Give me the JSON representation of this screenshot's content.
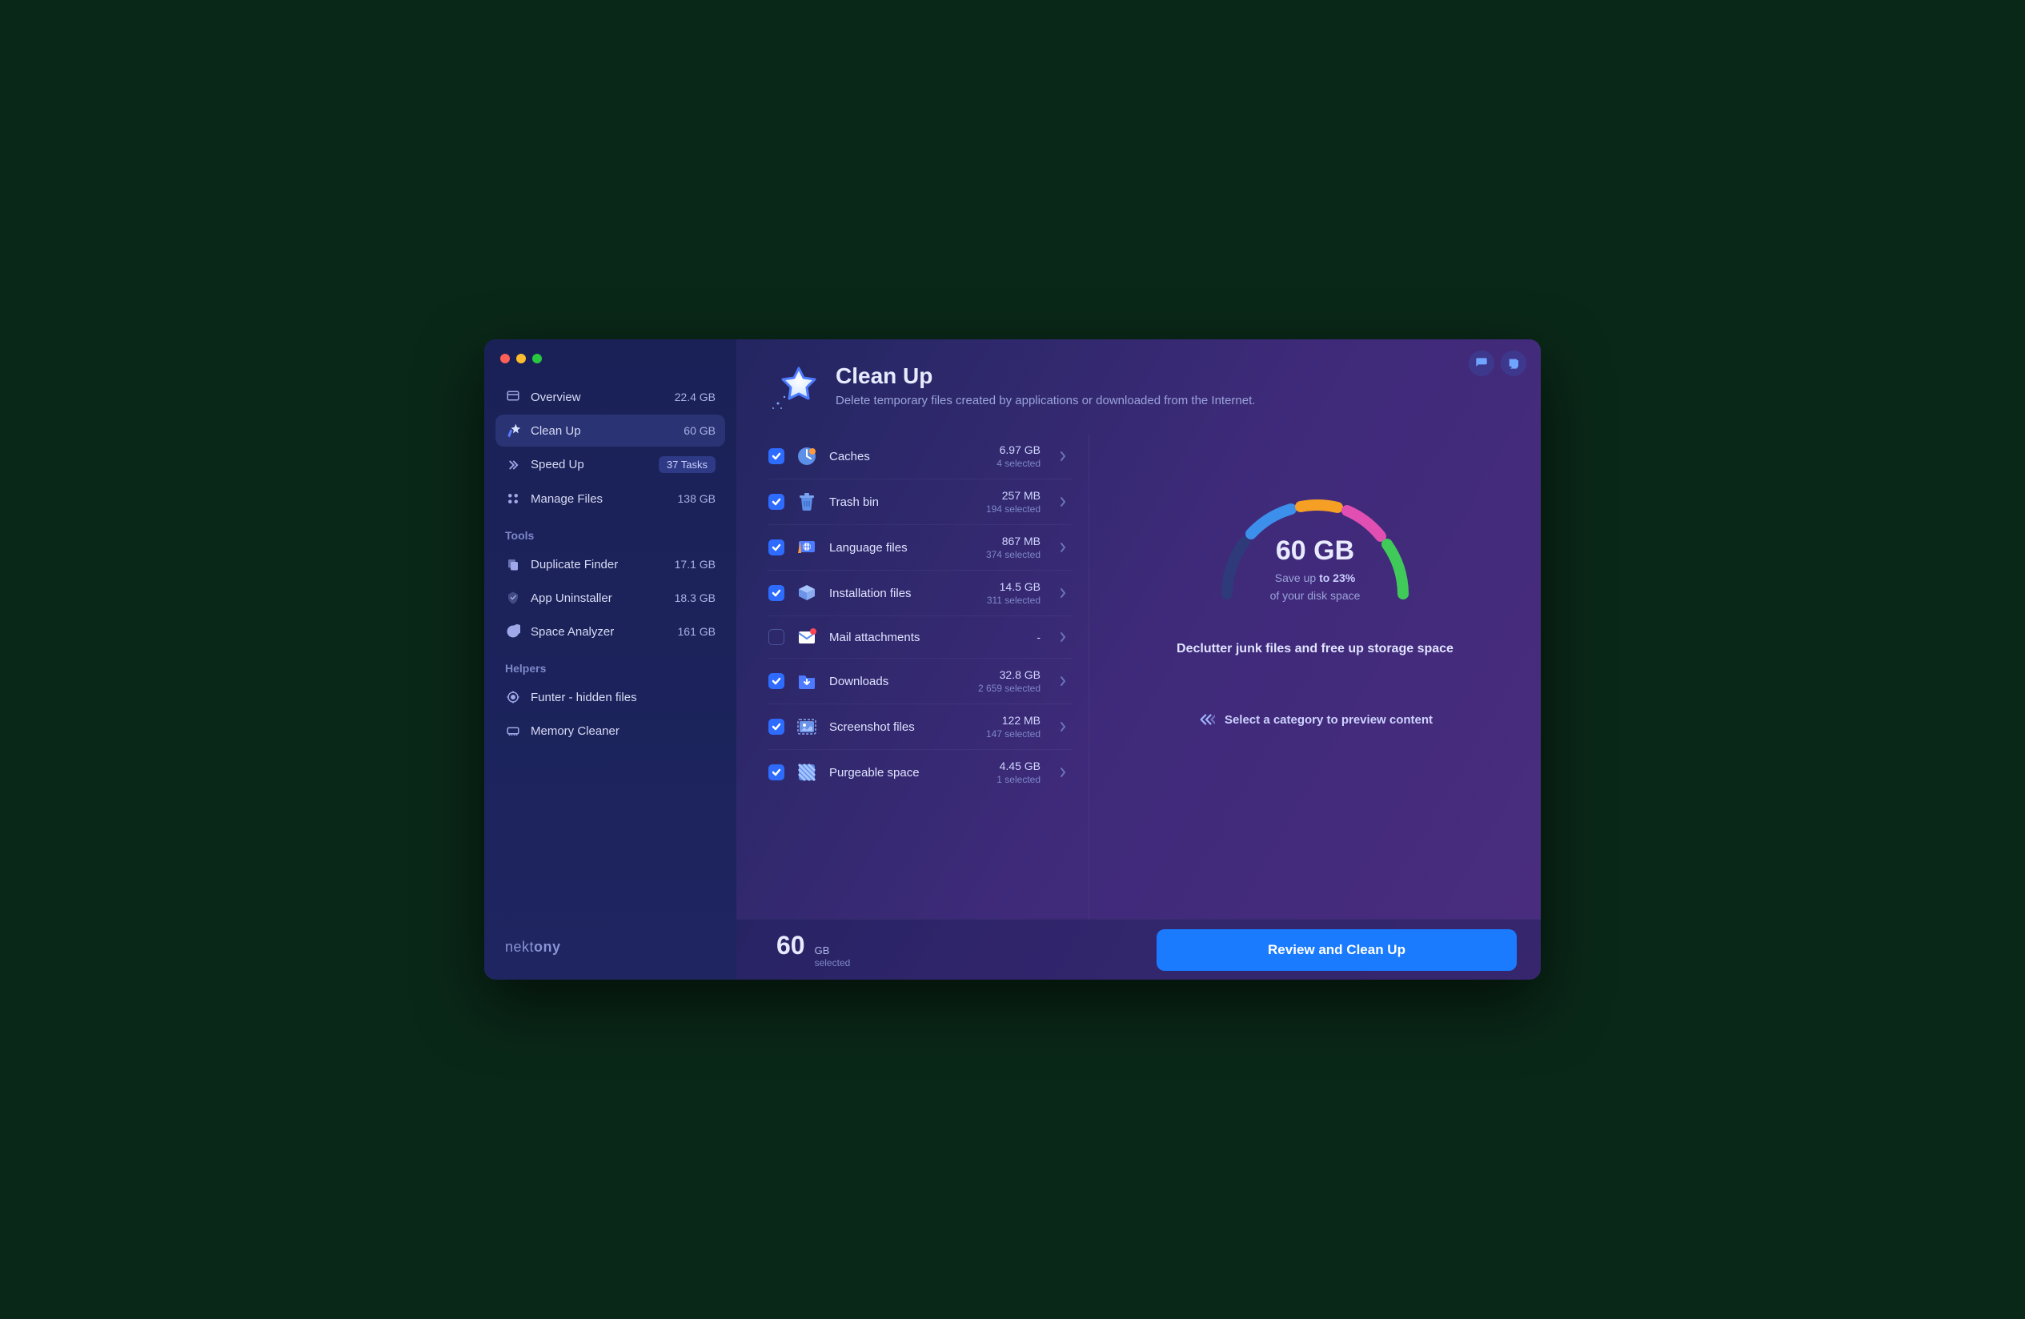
{
  "sidebar": {
    "nav": [
      {
        "label": "Overview",
        "value": "22.4 GB",
        "icon": "overview"
      },
      {
        "label": "Clean Up",
        "value": "60 GB",
        "icon": "cleanup",
        "active": true
      },
      {
        "label": "Speed Up",
        "value": "37 Tasks",
        "icon": "speedup",
        "badge": true
      },
      {
        "label": "Manage Files",
        "value": "138 GB",
        "icon": "manage"
      }
    ],
    "tools_header": "Tools",
    "tools": [
      {
        "label": "Duplicate Finder",
        "value": "17.1 GB",
        "icon": "duplicate"
      },
      {
        "label": "App Uninstaller",
        "value": "18.3 GB",
        "icon": "uninstall"
      },
      {
        "label": "Space Analyzer",
        "value": "161 GB",
        "icon": "analyzer"
      }
    ],
    "helpers_header": "Helpers",
    "helpers": [
      {
        "label": "Funter - hidden files",
        "value": "",
        "icon": "funter"
      },
      {
        "label": "Memory Cleaner",
        "value": "",
        "icon": "memory"
      }
    ],
    "brand_prefix": "nekt",
    "brand_suffix": "ony"
  },
  "header": {
    "title": "Clean Up",
    "subtitle": "Delete temporary files created by applications or downloaded from the Internet."
  },
  "categories": [
    {
      "name": "Caches",
      "size": "6.97 GB",
      "selected": "4 selected",
      "checked": true,
      "icon": "caches"
    },
    {
      "name": "Trash bin",
      "size": "257 MB",
      "selected": "194 selected",
      "checked": true,
      "icon": "trash"
    },
    {
      "name": "Language files",
      "size": "867 MB",
      "selected": "374 selected",
      "checked": true,
      "icon": "language"
    },
    {
      "name": "Installation files",
      "size": "14.5 GB",
      "selected": "311 selected",
      "checked": true,
      "icon": "install"
    },
    {
      "name": "Mail attachments",
      "size": "-",
      "selected": "",
      "checked": false,
      "icon": "mail"
    },
    {
      "name": "Downloads",
      "size": "32.8 GB",
      "selected": "2 659 selected",
      "checked": true,
      "icon": "downloads"
    },
    {
      "name": "Screenshot files",
      "size": "122 MB",
      "selected": "147 selected",
      "checked": true,
      "icon": "screenshot"
    },
    {
      "name": "Purgeable space",
      "size": "4.45 GB",
      "selected": "1 selected",
      "checked": true,
      "icon": "purgeable"
    }
  ],
  "gauge": {
    "big": "60 GB",
    "line1_a": "Save up ",
    "line1_b": "to 23%",
    "line2": "of your disk space"
  },
  "right": {
    "declutter": "Declutter junk files and free up storage space",
    "hint": "Select a category to preview content"
  },
  "footer": {
    "big": "60",
    "unit": "GB",
    "sub": "selected",
    "cta": "Review and Clean Up"
  }
}
